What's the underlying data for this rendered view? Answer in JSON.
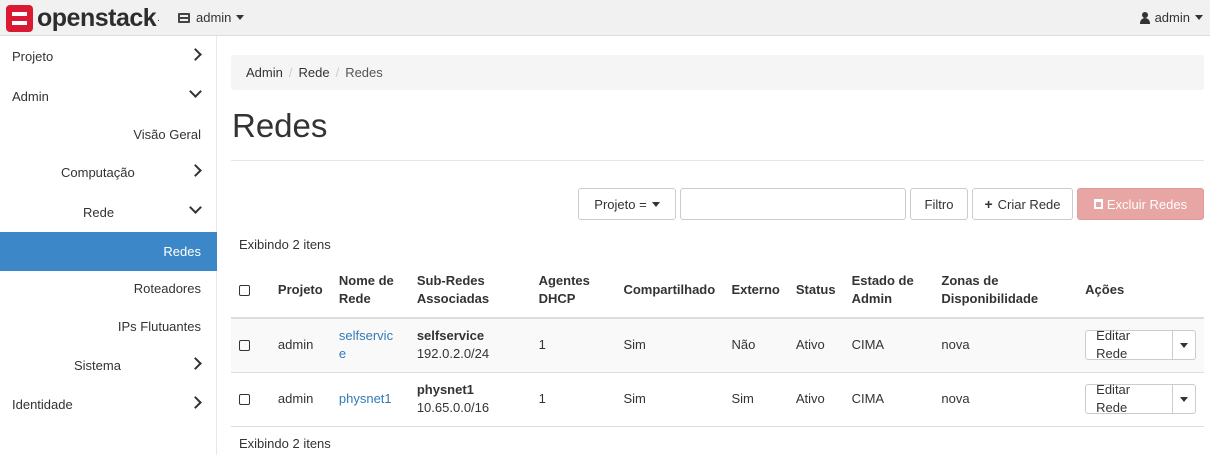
{
  "navbar": {
    "brand": "openstack",
    "brand_dot": ".",
    "project_menu": "admin",
    "user_menu": "admin"
  },
  "sidebar": {
    "items": [
      {
        "label": "Projeto"
      },
      {
        "label": "Admin"
      },
      {
        "label": "Visão Geral"
      },
      {
        "label": "Computação"
      },
      {
        "label": "Rede"
      },
      {
        "label": "Redes"
      },
      {
        "label": "Roteadores"
      },
      {
        "label": "IPs Flutuantes"
      },
      {
        "label": "Sistema"
      },
      {
        "label": "Identidade"
      }
    ]
  },
  "breadcrumb": {
    "items": [
      "Admin",
      "Rede",
      "Redes"
    ],
    "separator": "/"
  },
  "page": {
    "title": "Redes"
  },
  "toolbar": {
    "filter_select": "Projeto =",
    "filter_value": "",
    "filter_button": "Filtro",
    "create_button": "Criar Rede",
    "delete_button": "Excluir Redes"
  },
  "table": {
    "count_top": "Exibindo 2 itens",
    "count_bottom": "Exibindo 2 itens",
    "headers": {
      "project": "Projeto",
      "name_1": "Nome de",
      "name_2": "Rede",
      "subnets_1": "Sub-Redes",
      "subnets_2": "Associadas",
      "dhcp_1": "Agentes",
      "dhcp_2": "DHCP",
      "shared": "Compartilhado",
      "external": "Externo",
      "status": "Status",
      "admin_state_1": "Estado de",
      "admin_state_2": "Admin",
      "zones_1": "Zonas de",
      "zones_2": "Disponibilidade",
      "actions": "Ações"
    },
    "rows": [
      {
        "project": "admin",
        "name_1": "selfservic",
        "name_2": "e",
        "subnet_name": "selfservice",
        "subnet_cidr": "192.0.2.0/24",
        "dhcp_agents": "1",
        "shared": "Sim",
        "external": "Não",
        "status": "Ativo",
        "admin_state": "CIMA",
        "zones": "nova",
        "action": "Editar Rede"
      },
      {
        "project": "admin",
        "name_1": "physnet1",
        "name_2": "",
        "subnet_name": "physnet1",
        "subnet_cidr": "10.65.0.0/16",
        "dhcp_agents": "1",
        "shared": "Sim",
        "external": "Sim",
        "status": "Ativo",
        "admin_state": "CIMA",
        "zones": "nova",
        "action": "Editar Rede"
      }
    ]
  }
}
